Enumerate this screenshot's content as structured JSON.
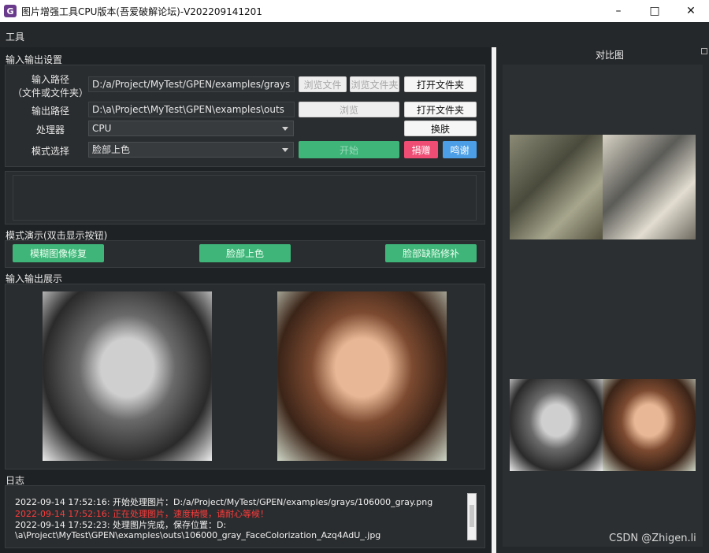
{
  "window": {
    "title": "图片增强工具CPU版本(吾爱破解论坛)-V202209141201",
    "icon_letter": "G",
    "minimize": "–",
    "maximize": "□",
    "close": "✕"
  },
  "menu": {
    "tools": "工具"
  },
  "io_settings": {
    "title": "输入输出设置",
    "input_label_line1": "输入路径",
    "input_label_line2": "（文件或文件夹）",
    "input_path": "D:/a/Project/MyTest/GPEN/examples/grays",
    "browse_file": "浏览文件",
    "browse_folder": "浏览文件夹",
    "open_folder_1": "打开文件夹",
    "output_label": "输出路径",
    "output_path": "D:\\a\\Project\\MyTest\\GPEN\\examples\\outs",
    "browse": "浏览",
    "open_folder_2": "打开文件夹",
    "processor_label": "处理器",
    "processor_value": "CPU",
    "skin": "换肤",
    "mode_label": "模式选择",
    "mode_value": "脸部上色",
    "start": "开始",
    "donate": "捐赠",
    "thanks": "鸣谢"
  },
  "demo": {
    "title": "模式演示(双击显示按钮)",
    "btn_deblur": "模糊图像修复",
    "btn_colorize": "脸部上色",
    "btn_inpaint": "脸部缺陷修补"
  },
  "display": {
    "title": "输入输出展示"
  },
  "log": {
    "title": "日志",
    "lines": [
      "2022-09-14 17:52:16: 开始处理图片：D:/a/Project/MyTest/GPEN/examples/grays/106000_gray.png",
      "2022-09-14 17:52:16: 正在处理图片，速度稍慢，请耐心等候！",
      "2022-09-14 17:52:23: 处理图片完成，保存位置：D:",
      "\\a\\Project\\MyTest\\GPEN\\examples\\outs\\106000_gray_FaceColorization_Azq4AdU_.jpg"
    ]
  },
  "compare": {
    "title": "对比图"
  },
  "watermark": "CSDN @Zhigen.li"
}
